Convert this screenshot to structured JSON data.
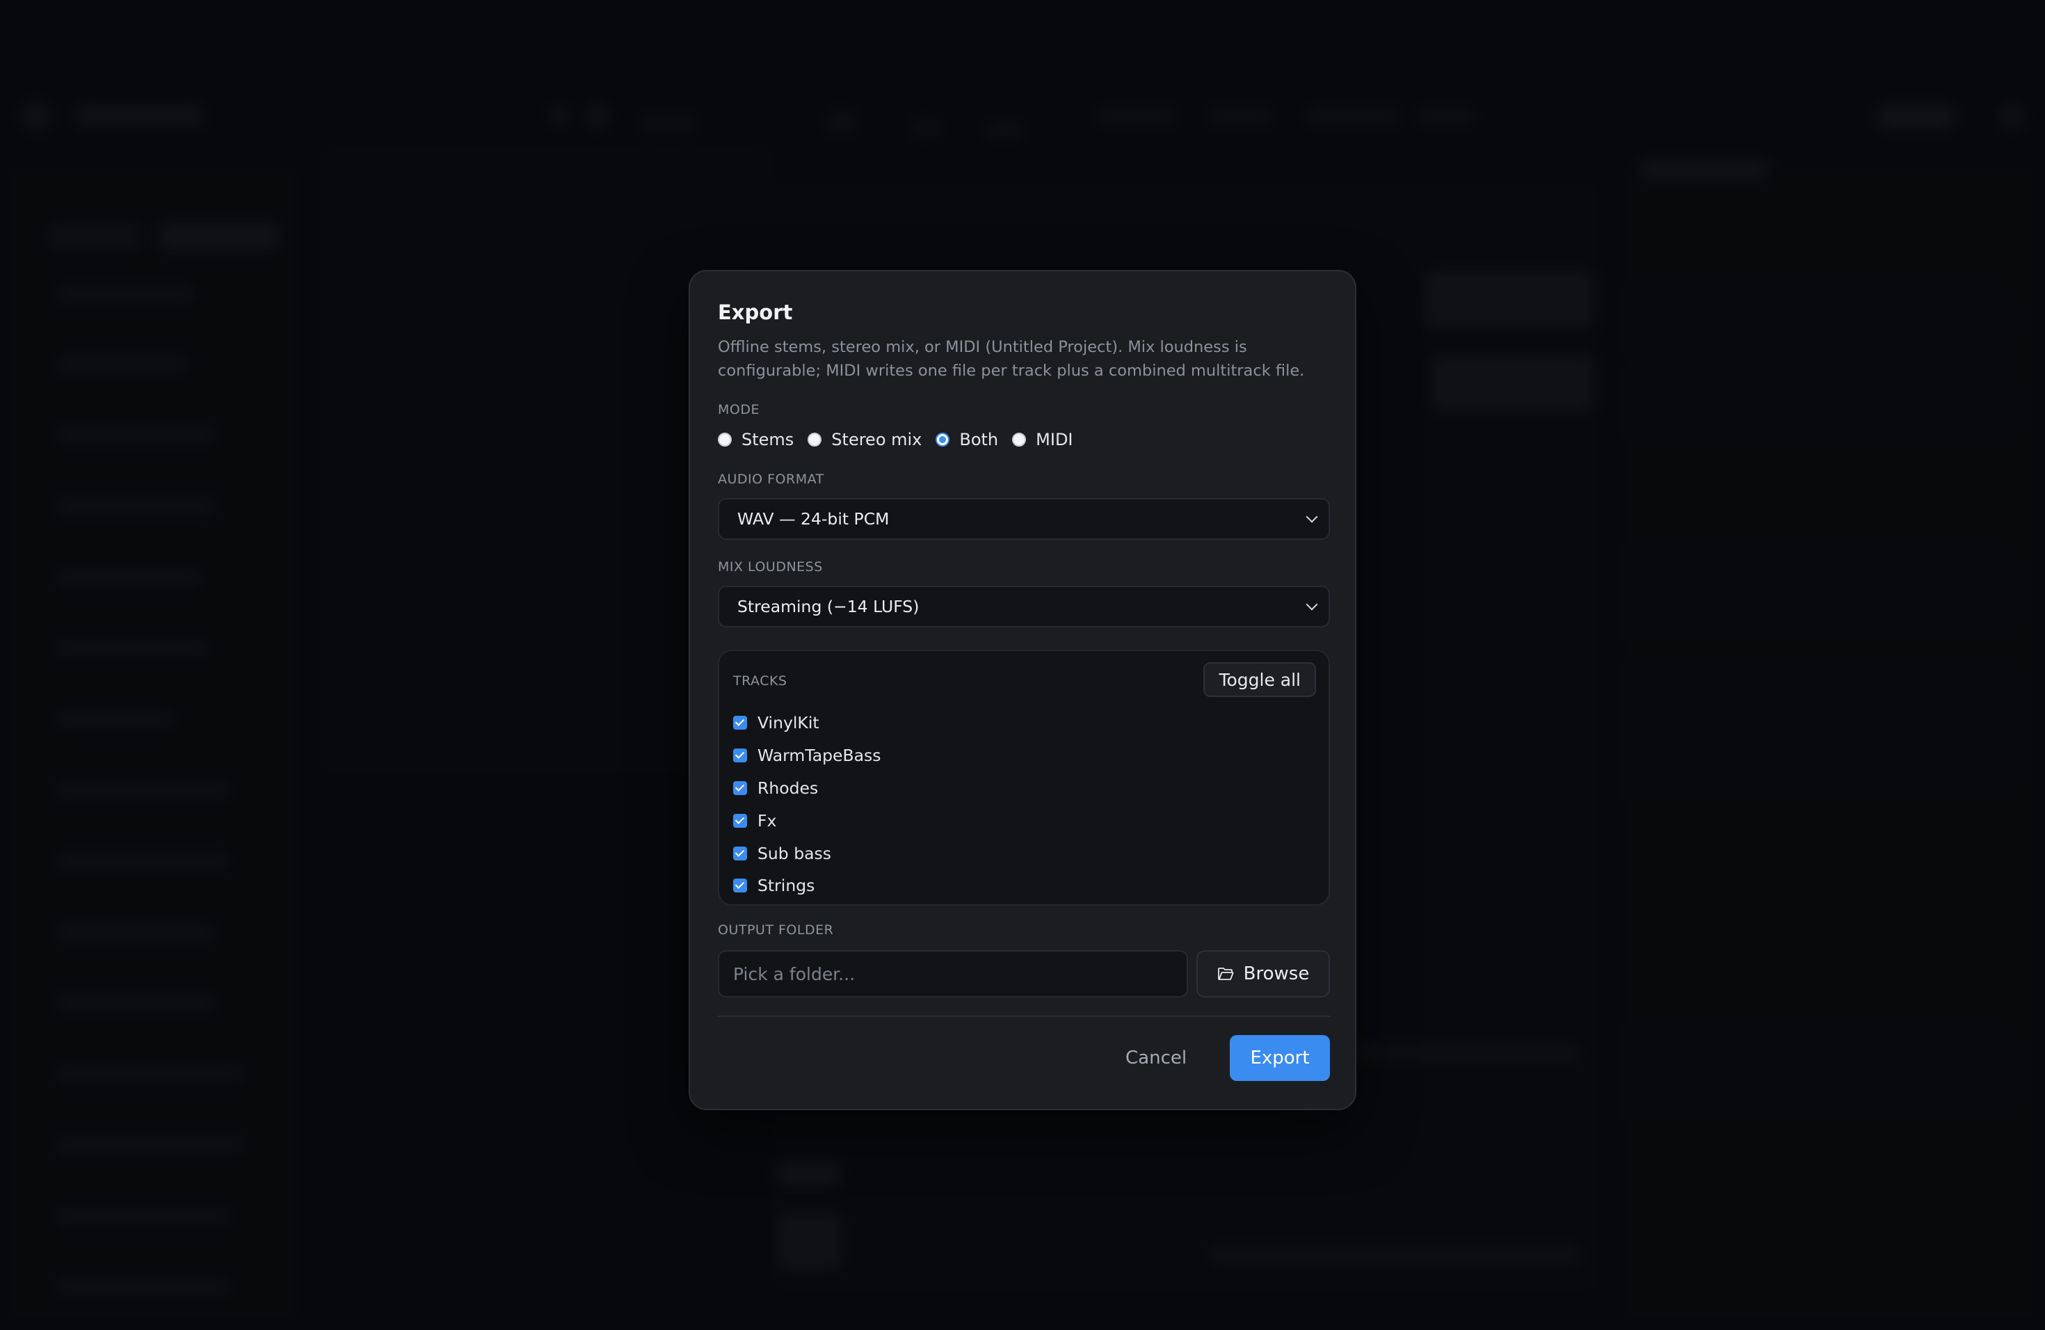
{
  "dialog": {
    "title": "Export",
    "description": "Offline stems, stereo mix, or MIDI (Untitled Project). Mix loudness is configurable; MIDI writes one file per track plus a combined multitrack file."
  },
  "mode": {
    "label": "MODE",
    "options": [
      {
        "label": "Stems",
        "checked": false
      },
      {
        "label": "Stereo mix",
        "checked": false
      },
      {
        "label": "Both",
        "checked": true
      },
      {
        "label": "MIDI",
        "checked": false
      }
    ],
    "selected": "Both"
  },
  "audio_format": {
    "label": "AUDIO FORMAT",
    "value": "WAV — 24-bit PCM"
  },
  "mix_loudness": {
    "label": "MIX LOUDNESS",
    "value": "Streaming (−14 LUFS)"
  },
  "tracks": {
    "label": "TRACKS",
    "toggle_all_label": "Toggle all",
    "items": [
      {
        "name": "VinylKit",
        "checked": true
      },
      {
        "name": "WarmTapeBass",
        "checked": true
      },
      {
        "name": "Rhodes",
        "checked": true
      },
      {
        "name": "Fx",
        "checked": true
      },
      {
        "name": "Sub bass",
        "checked": true
      },
      {
        "name": "Strings",
        "checked": true
      }
    ]
  },
  "output_folder": {
    "label": "OUTPUT FOLDER",
    "placeholder": "Pick a folder...",
    "value": "",
    "browse_label": "Browse",
    "browse_icon": "folder-open-icon"
  },
  "actions": {
    "cancel_label": "Cancel",
    "export_label": "Export"
  },
  "colors": {
    "accent": "#3b8cf0",
    "dialog_bg": "#1b1d21",
    "backdrop": "#0b0c0e"
  }
}
